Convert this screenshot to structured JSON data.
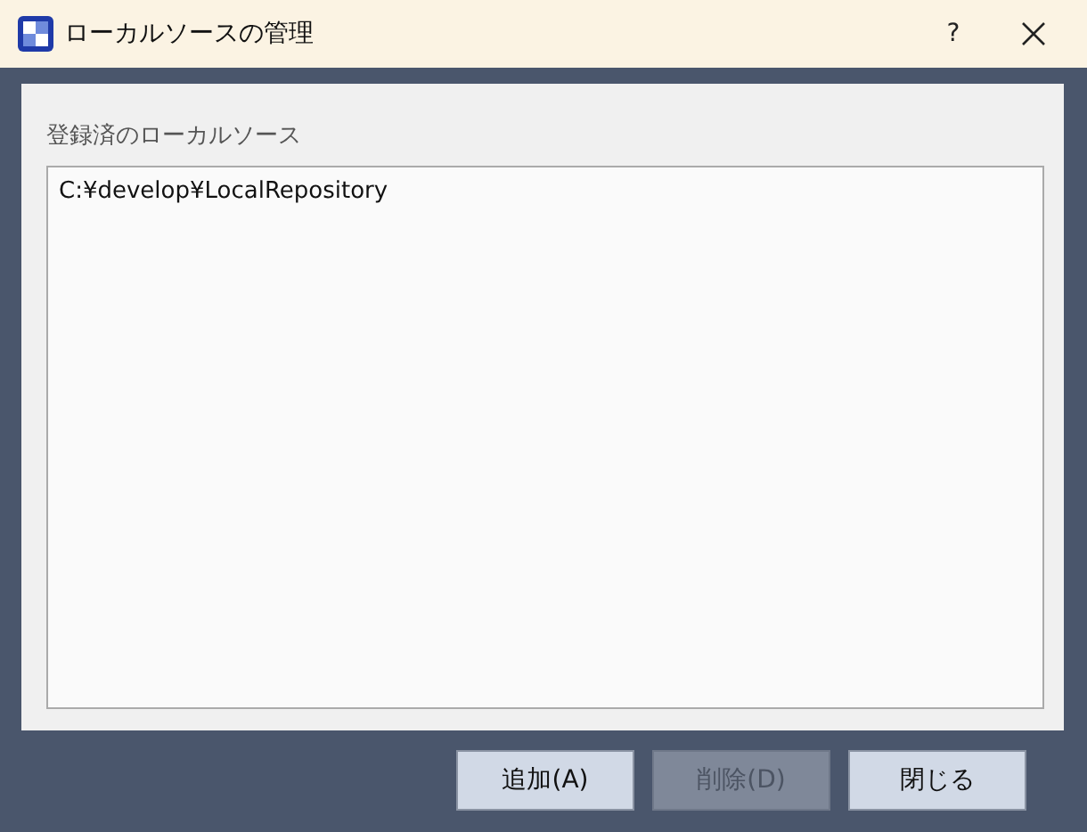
{
  "window": {
    "title": "ローカルソースの管理",
    "help": "?"
  },
  "list": {
    "label": "登録済のローカルソース",
    "items": [
      "C:¥develop¥LocalRepository"
    ]
  },
  "buttons": [
    {
      "label": "追加(A)",
      "disabled": false
    },
    {
      "label": "削除(D)",
      "disabled": true
    },
    {
      "label": "閉じる",
      "disabled": false
    }
  ]
}
